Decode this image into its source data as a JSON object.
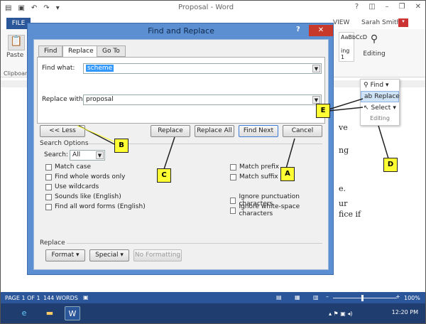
{
  "word": {
    "title": "Proposal - Word",
    "file_tab": "FILE",
    "view_tab": "VIEW",
    "user": "Sarah Smith",
    "paste_label": "Paste",
    "clipboard_label": "Clipboard",
    "style_preview": "AaBbCcD",
    "style_line2": "ing 1",
    "editing_label": "Editing",
    "doc_fragments": [
      "ve",
      "ng",
      "e.",
      "ur",
      "fice if"
    ]
  },
  "editing_menu": {
    "items": [
      {
        "label": "Find",
        "icon": "find-icon"
      },
      {
        "label": "Replace",
        "icon": "replace-icon"
      },
      {
        "label": "Select",
        "icon": "select-icon"
      }
    ],
    "footer": "Editing"
  },
  "status": {
    "page": "PAGE 1 OF 1",
    "words": "144 WORDS",
    "zoom": "100%"
  },
  "taskbar": {
    "clock": "12:20 PM"
  },
  "dialog": {
    "title": "Find and Replace",
    "help": "?",
    "close": "✕",
    "tabs": [
      "Find",
      "Replace",
      "Go To"
    ],
    "active_tab": "Replace",
    "find_label": "Find what:",
    "find_value": "scheme",
    "replace_label": "Replace with:",
    "replace_value": "proposal",
    "buttons": {
      "less": "<< Less",
      "replace": "Replace",
      "replace_all": "Replace All",
      "find_next": "Find Next",
      "cancel": "Cancel"
    },
    "search_options_label": "Search Options",
    "search_label": "Search:",
    "search_value": "All",
    "left_options": [
      "Match case",
      "Find whole words only",
      "Use wildcards",
      "Sounds like (English)",
      "Find all word forms (English)"
    ],
    "right_options": [
      "Match prefix",
      "Match suffix",
      "Ignore punctuation characters",
      "Ignore white-space characters"
    ],
    "replace_section_label": "Replace",
    "format_button": "Format",
    "special_button": "Special",
    "no_formatting_button": "No Formatting"
  },
  "callouts": [
    "A",
    "B",
    "C",
    "D",
    "E"
  ],
  "colors": {
    "callout": "#ffff33",
    "dialog_frame": "#5b8fd1",
    "word_blue": "#2b579a",
    "close_red": "#c7392b"
  }
}
